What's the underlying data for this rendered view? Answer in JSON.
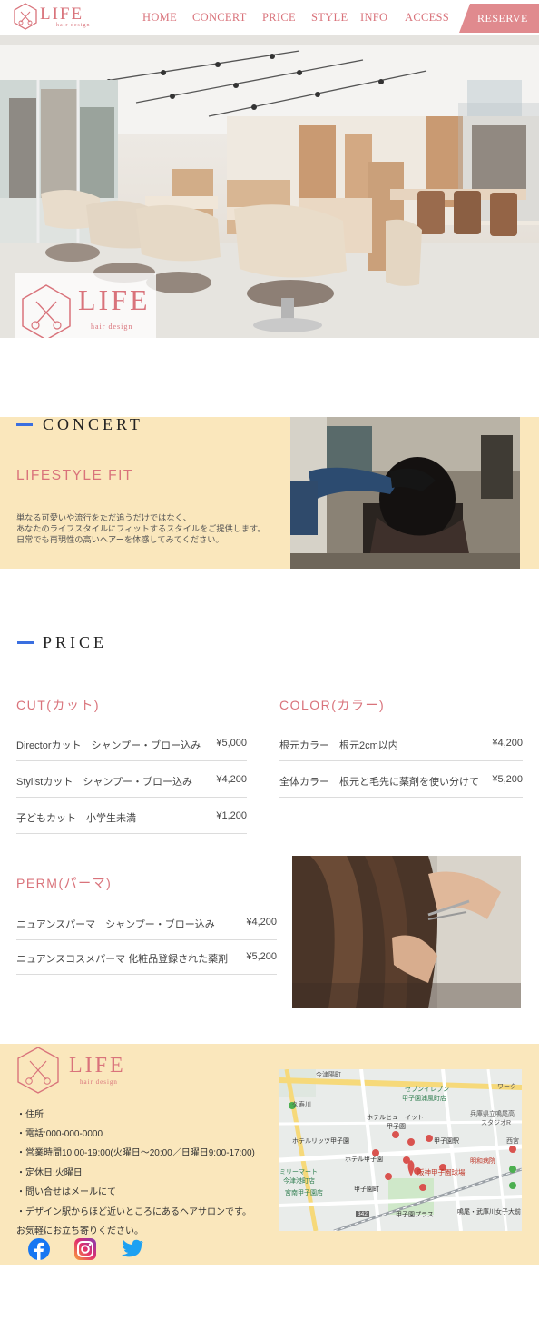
{
  "brand": {
    "name": "LIFE",
    "tagline": "hair design",
    "color": "#d9737b"
  },
  "nav": {
    "items": [
      "HOME",
      "CONCERT",
      "PRICE",
      "STYLE",
      "INFO",
      "ACCESS"
    ],
    "reserve": "RESERVE",
    "reserve_color": "#e08a8e"
  },
  "concert": {
    "title": "CONCERT",
    "subtitle": "LIFESTYLE FIT",
    "lines": [
      "単なる可愛いや流行をただ追うだけではなく、",
      "あなたのライフスタイルにフィットするスタイルをご提供します。",
      "日常でも再現性の高いヘアーを体感してみてください。"
    ],
    "bg": "#fae7bc"
  },
  "price": {
    "title": "PRICE",
    "cut": {
      "heading": "CUT(カット)",
      "rows": [
        {
          "label": "Directorカット　シャンプー・ブロー込み",
          "amount": "¥5,000"
        },
        {
          "label": "Stylistカット　シャンプー・ブロー込み",
          "amount": "¥4,200"
        },
        {
          "label": "子どもカット　小学生未満",
          "amount": "¥1,200"
        }
      ]
    },
    "color": {
      "heading": "COLOR(カラー)",
      "rows": [
        {
          "label": "根元カラー　根元2cm以内",
          "amount": "¥4,200"
        },
        {
          "label": "全体カラー　根元と毛先に薬剤を使い分けて",
          "amount": "¥5,200"
        }
      ]
    },
    "perm": {
      "heading": "PERM(パーマ)",
      "rows": [
        {
          "label": "ニュアンスパーマ　シャンプー・ブロー込み",
          "amount": "¥4,200"
        },
        {
          "label": "ニュアンスコスメパーマ 化粧品登録された薬剤",
          "amount": "¥5,200"
        }
      ]
    }
  },
  "footer": {
    "info": [
      "・住所",
      "・電話:000-000-0000",
      "・営業時間10:00-19:00(火曜日〜20:00／日曜日9:00-17:00)",
      "・定休日:火曜日",
      "・問い合せはメールにて",
      "・デザイン駅からほど近いところにあるヘアサロンです。",
      "お気軽にお立ち寄りください。"
    ],
    "social": [
      "facebook-icon",
      "instagram-icon",
      "twitter-icon"
    ]
  },
  "map": {
    "labels": {
      "l1": "今津陽町",
      "l2": "セブンイレブン",
      "l3": "甲子園浦風町店",
      "l4": "ワーク",
      "l5": "久寿川",
      "l6": "ホテルヒューイット",
      "l7": "甲子園",
      "l8": "兵庫県立鳴尾高",
      "l9": "スタジオR",
      "l10": "ホテルリッツ甲子園",
      "l11": "甲子園駅",
      "l12": "西宮",
      "l13": "ホテル甲子園",
      "l14": "明和病院",
      "l15": "ミリーマート",
      "l16": "今津港町店",
      "l17": "阪神甲子園球場",
      "l18": "甲子園町",
      "l19": "宮南甲子園店",
      "l20": "甲子園プラス",
      "l21": "鳴尾・武庫川女子大前",
      "l22": "342"
    }
  }
}
